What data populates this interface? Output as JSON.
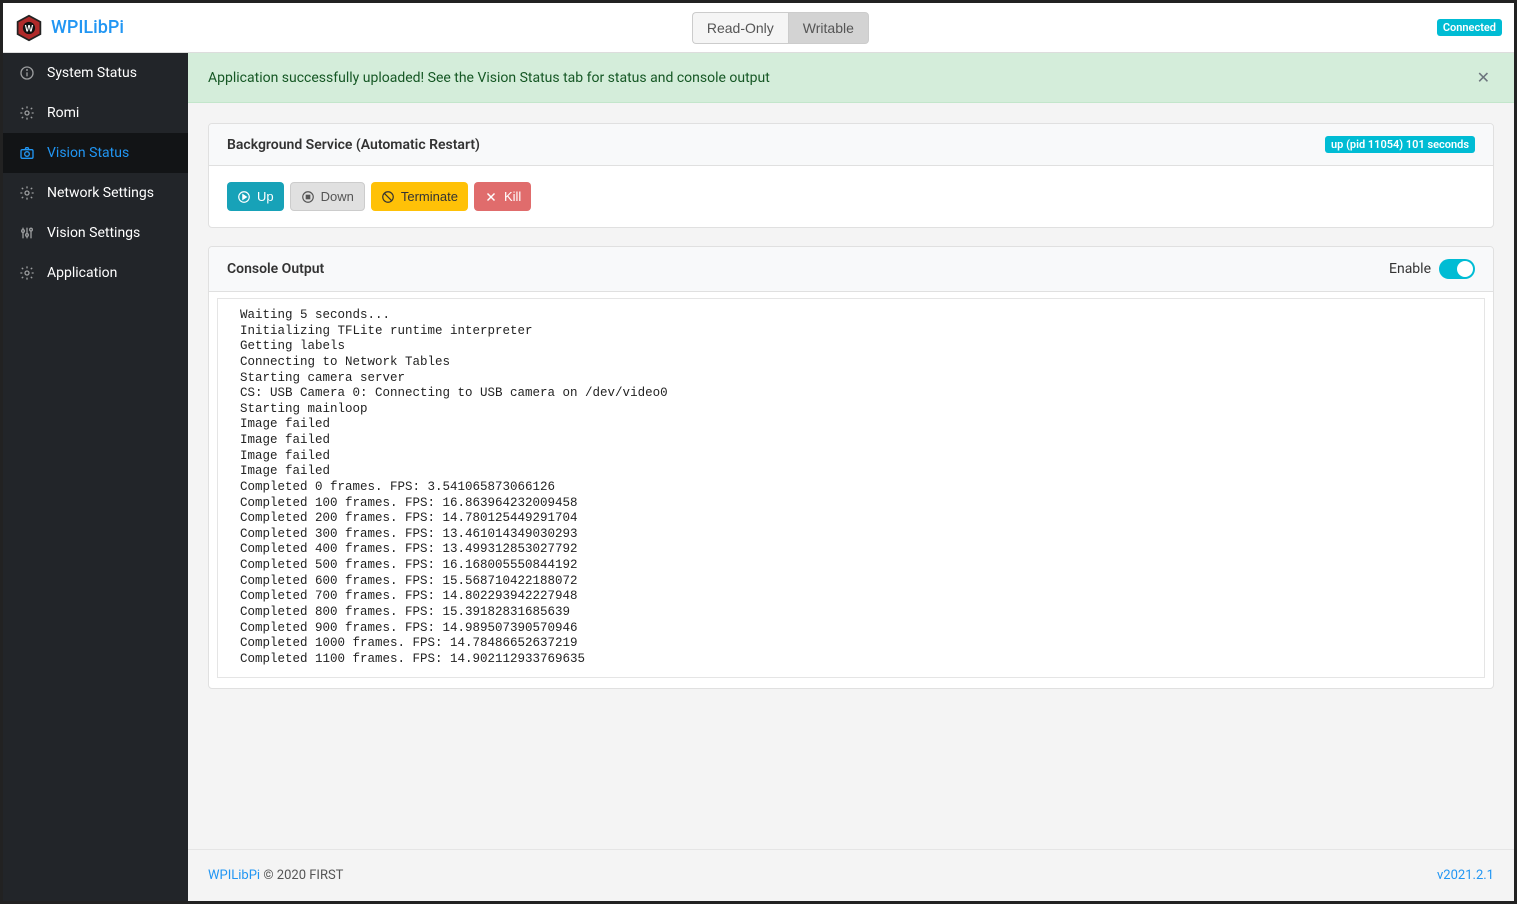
{
  "brand": "WPILibPi",
  "top": {
    "read_only": "Read-Only",
    "writable": "Writable",
    "connected": "Connected"
  },
  "sidebar": {
    "items": [
      {
        "label": "System Status"
      },
      {
        "label": "Romi"
      },
      {
        "label": "Vision Status"
      },
      {
        "label": "Network Settings"
      },
      {
        "label": "Vision Settings"
      },
      {
        "label": "Application"
      }
    ]
  },
  "alert": {
    "text": "Application successfully uploaded! See the Vision Status tab for status and console output"
  },
  "service": {
    "title": "Background Service (Automatic Restart)",
    "status": "up (pid 11054) 101 seconds",
    "buttons": {
      "up": "Up",
      "down": "Down",
      "terminate": "Terminate",
      "kill": "Kill"
    }
  },
  "console": {
    "title": "Console Output",
    "enable_label": "Enable",
    "text": "Waiting 5 seconds...\nInitializing TFLite runtime interpreter\nGetting labels\nConnecting to Network Tables\nStarting camera server\nCS: USB Camera 0: Connecting to USB camera on /dev/video0\nStarting mainloop\nImage failed\nImage failed\nImage failed\nImage failed\nCompleted 0 frames. FPS: 3.541065873066126\nCompleted 100 frames. FPS: 16.863964232009458\nCompleted 200 frames. FPS: 14.780125449291704\nCompleted 300 frames. FPS: 13.461014349030293\nCompleted 400 frames. FPS: 13.499312853027792\nCompleted 500 frames. FPS: 16.168005550844192\nCompleted 600 frames. FPS: 15.568710422188072\nCompleted 700 frames. FPS: 14.802293942227948\nCompleted 800 frames. FPS: 15.39182831685639\nCompleted 900 frames. FPS: 14.989507390570946\nCompleted 1000 frames. FPS: 14.78486652637219\nCompleted 1100 frames. FPS: 14.902112933769635"
  },
  "footer": {
    "link": "WPILibPi",
    "copyright": " © 2020 FIRST",
    "version": "v2021.2.1"
  }
}
